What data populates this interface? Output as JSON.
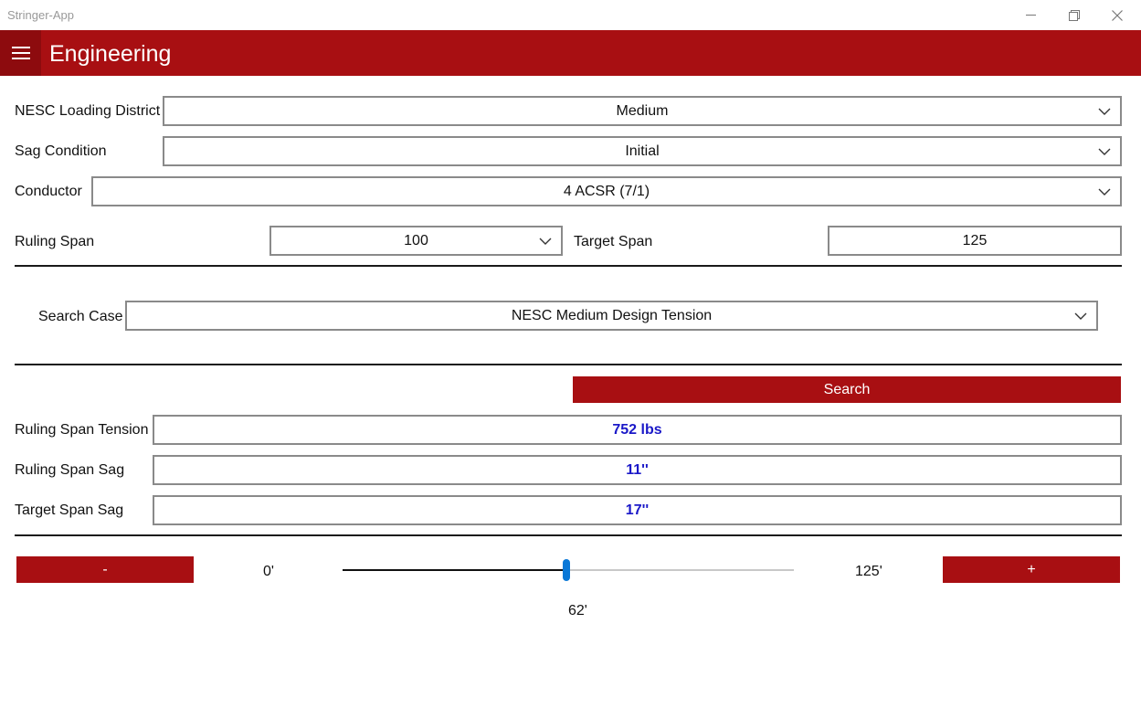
{
  "window": {
    "app_title": "Stringer-App"
  },
  "header": {
    "title": "Engineering"
  },
  "form": {
    "loading_district": {
      "label": "NESC Loading District",
      "value": "Medium"
    },
    "sag_condition": {
      "label": "Sag Condition",
      "value": "Initial"
    },
    "conductor": {
      "label": "Conductor",
      "value": "4 ACSR (7/1)"
    },
    "ruling_span": {
      "label": "Ruling Span",
      "value": "100"
    },
    "target_span": {
      "label": "Target Span",
      "value": "125"
    },
    "search_case": {
      "label": "Search Case",
      "value": "NESC Medium Design Tension"
    }
  },
  "search_button": "Search",
  "results": {
    "tension": {
      "label": "Ruling Span Tension",
      "value": "752 lbs"
    },
    "ruling_sag": {
      "label": "Ruling Span Sag",
      "value": "11''"
    },
    "target_sag": {
      "label": "Target Span Sag",
      "value": "17''"
    }
  },
  "slider": {
    "minus_label": "-",
    "plus_label": "+",
    "min_label": "0'",
    "max_label": "125'",
    "value_label": "62'",
    "min": 0,
    "max": 125,
    "value": 62
  },
  "colors": {
    "accent": "#a80f12",
    "result_text": "#1a18c8",
    "slider_thumb": "#0a78d7"
  }
}
